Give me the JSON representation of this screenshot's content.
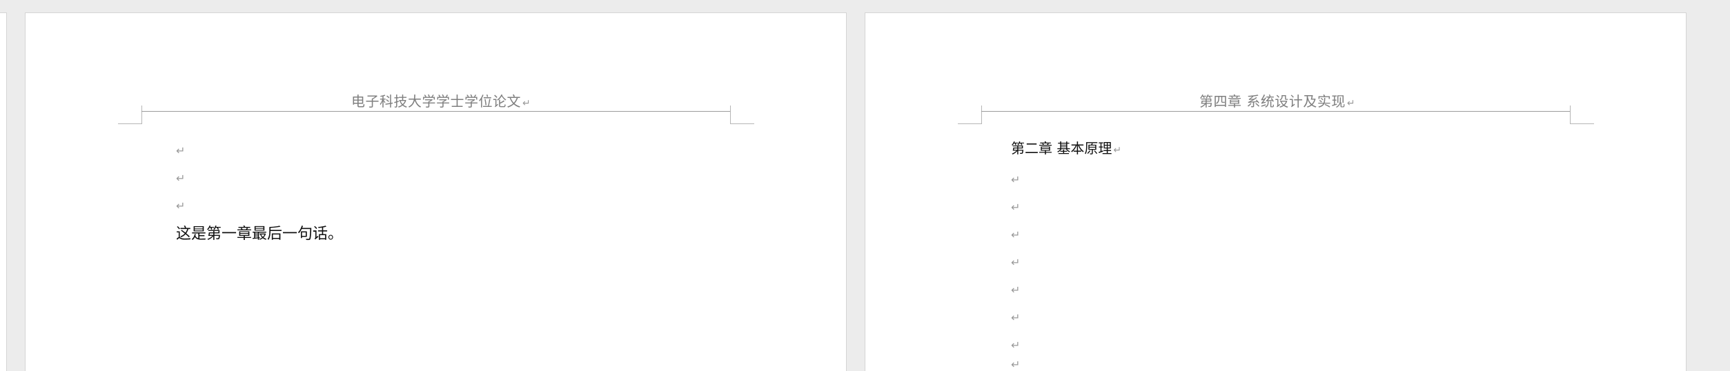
{
  "page1": {
    "header_text": "电子科技大学学士学位论文",
    "paragraph_mark": "↵",
    "empty_paragraphs": [
      "↵",
      "↵",
      "↵"
    ],
    "body_text": "这是第一章最后一句话。"
  },
  "page2": {
    "header_text": "第四章  系统设计及实现",
    "paragraph_mark": "↵",
    "heading_text": "第二章  基本原理",
    "empty_paragraphs": [
      "↵",
      "↵",
      "↵",
      "↵",
      "↵",
      "↵",
      "↵",
      "↵"
    ]
  }
}
